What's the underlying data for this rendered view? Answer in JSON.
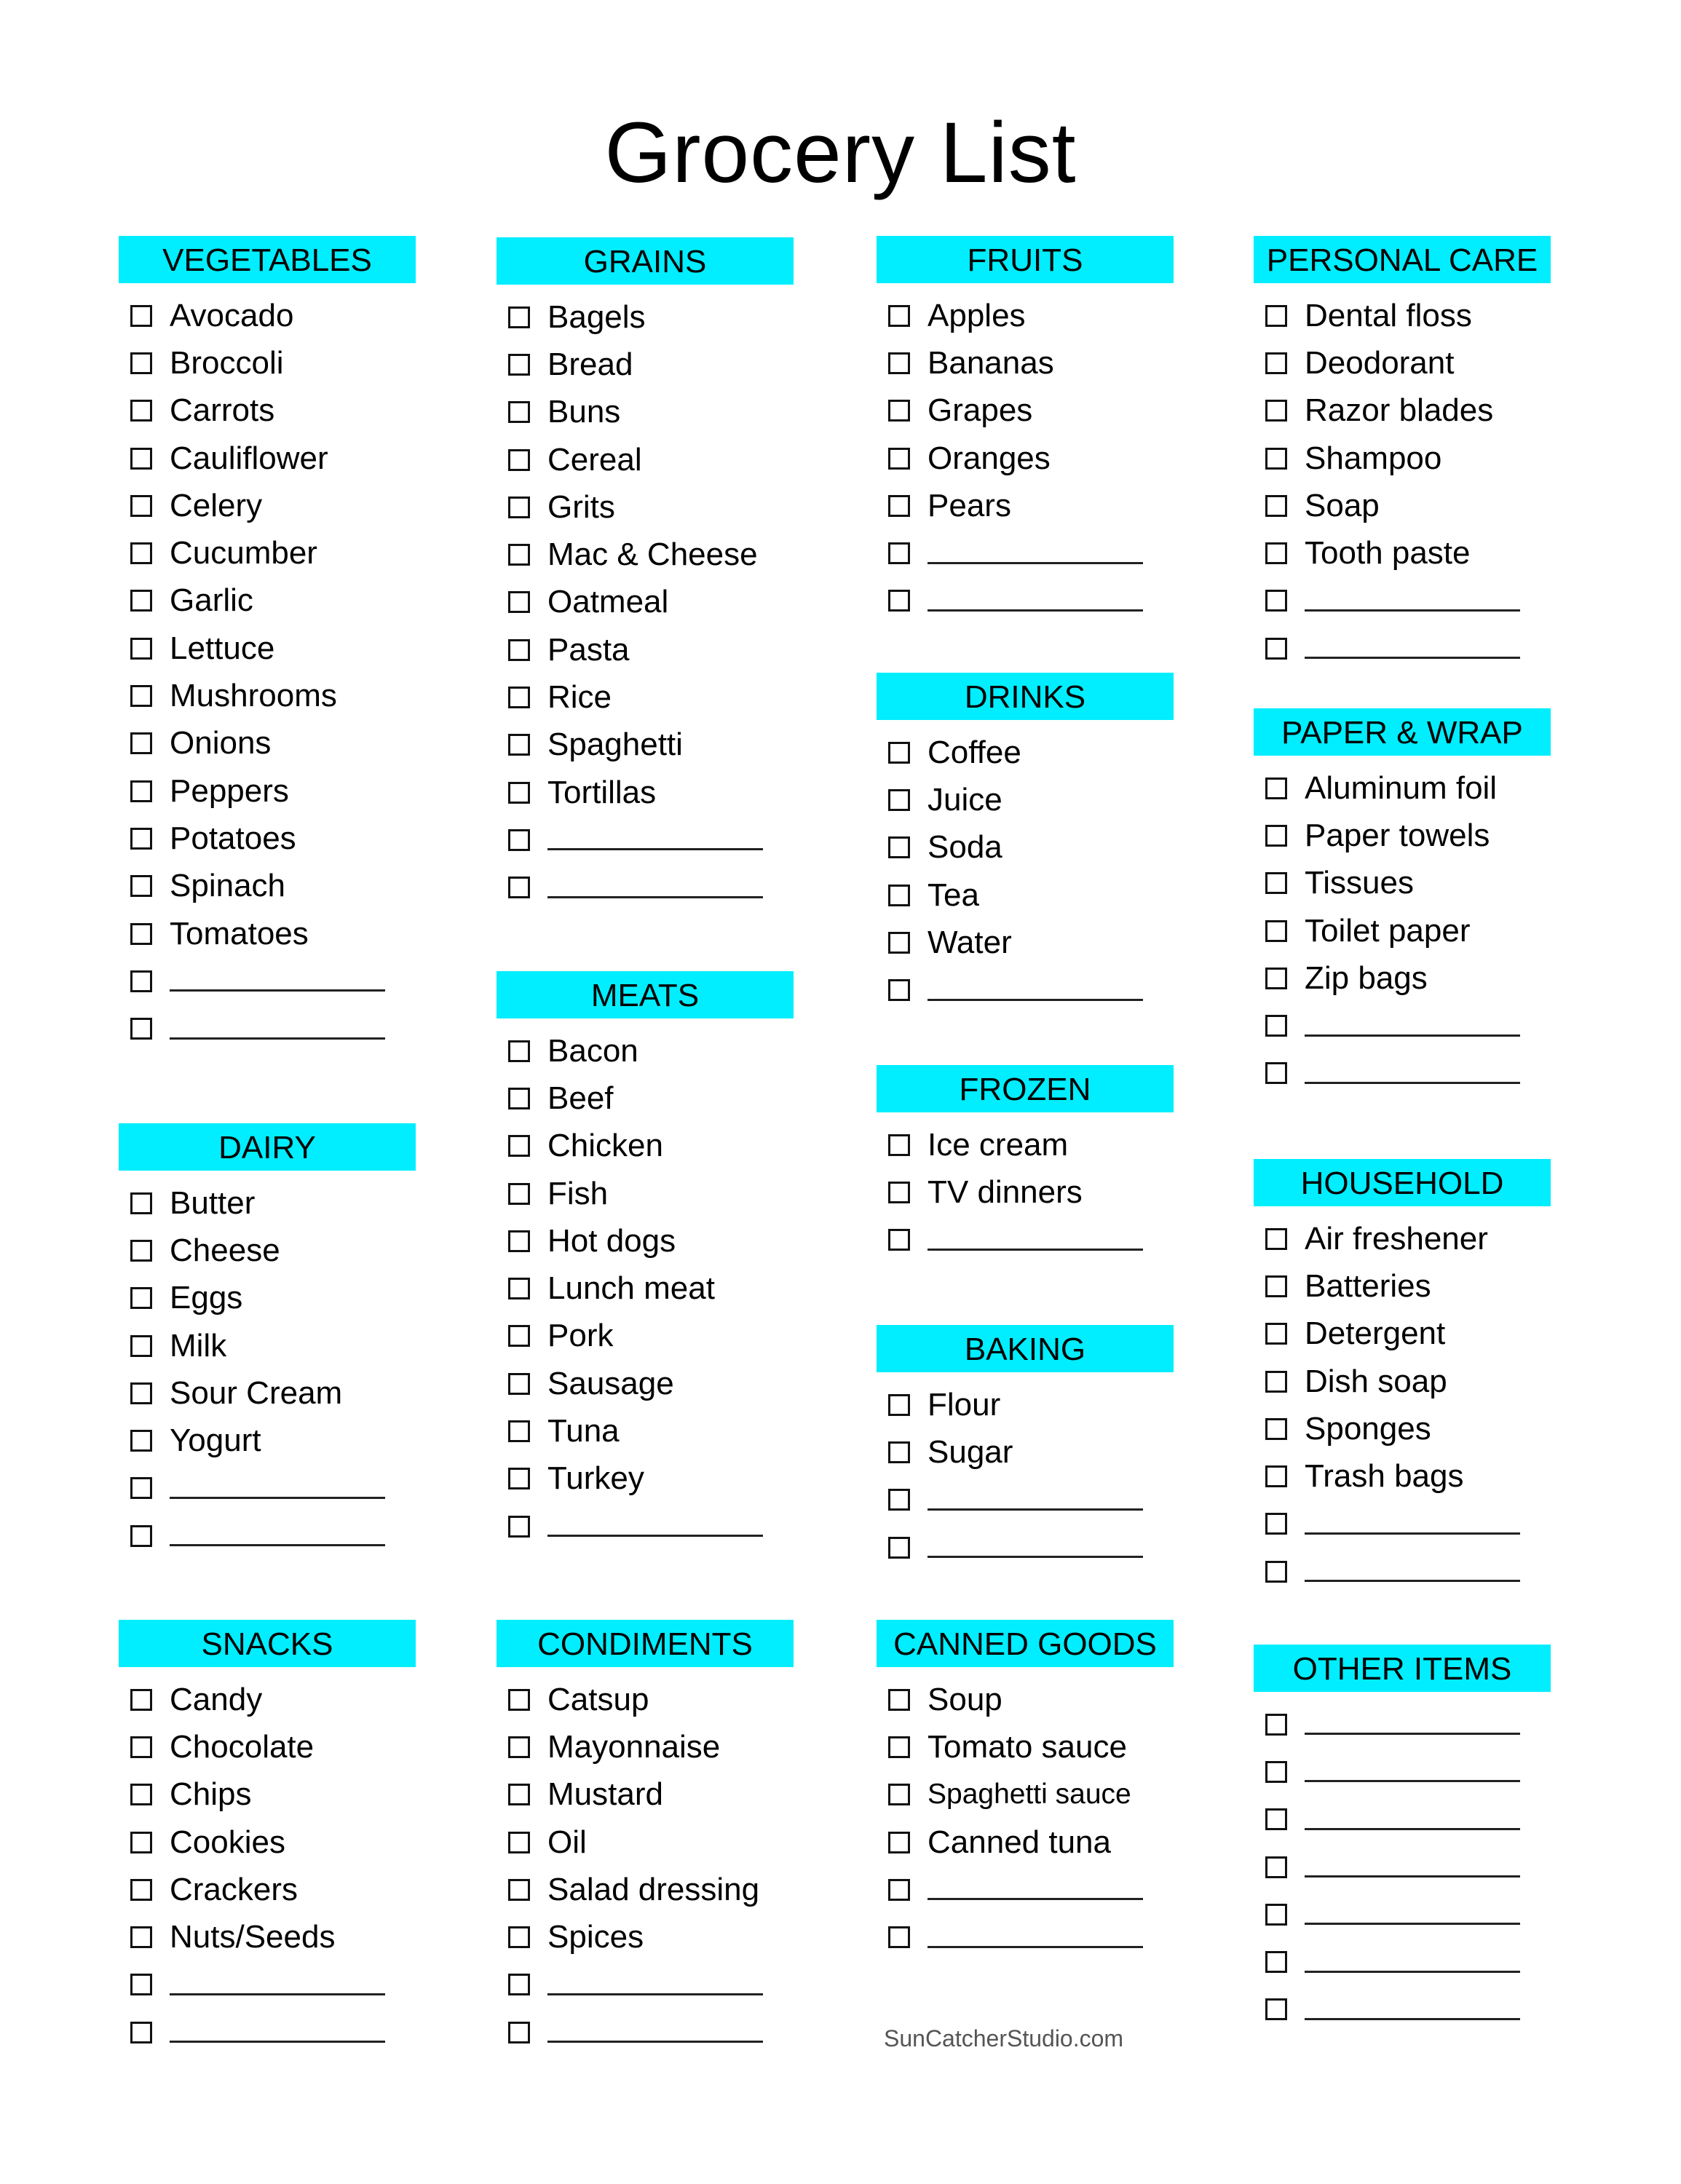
{
  "title": "Grocery List",
  "accent_color": "#00EEFF",
  "footer": "SunCatcherStudio.com",
  "sections": {
    "vegetables": {
      "title": "VEGETABLES",
      "items": [
        "Avocado",
        "Broccoli",
        "Carrots",
        "Cauliflower",
        "Celery",
        "Cucumber",
        "Garlic",
        "Lettuce",
        "Mushrooms",
        "Onions",
        "Peppers",
        "Potatoes",
        "Spinach",
        "Tomatoes",
        "",
        ""
      ]
    },
    "dairy": {
      "title": "DAIRY",
      "items": [
        "Butter",
        "Cheese",
        "Eggs",
        "Milk",
        "Sour Cream",
        "Yogurt",
        "",
        ""
      ]
    },
    "snacks": {
      "title": "SNACKS",
      "items": [
        "Candy",
        "Chocolate",
        "Chips",
        "Cookies",
        "Crackers",
        "Nuts/Seeds",
        "",
        ""
      ]
    },
    "grains": {
      "title": "GRAINS",
      "items": [
        "Bagels",
        "Bread",
        "Buns",
        "Cereal",
        "Grits",
        "Mac & Cheese",
        "Oatmeal",
        "Pasta",
        "Rice",
        "Spaghetti",
        "Tortillas",
        "",
        ""
      ]
    },
    "meats": {
      "title": "MEATS",
      "items": [
        "Bacon",
        "Beef",
        "Chicken",
        "Fish",
        "Hot dogs",
        "Lunch meat",
        "Pork",
        "Sausage",
        "Tuna",
        "Turkey",
        ""
      ]
    },
    "condiments": {
      "title": "CONDIMENTS",
      "items": [
        "Catsup",
        "Mayonnaise",
        "Mustard",
        "Oil",
        "Salad dressing",
        "Spices",
        "",
        ""
      ]
    },
    "fruits": {
      "title": "FRUITS",
      "items": [
        "Apples",
        "Bananas",
        "Grapes",
        "Oranges",
        "Pears",
        "",
        ""
      ]
    },
    "drinks": {
      "title": "DRINKS",
      "items": [
        "Coffee",
        "Juice",
        "Soda",
        "Tea",
        "Water",
        ""
      ]
    },
    "frozen": {
      "title": "FROZEN",
      "items": [
        "Ice cream",
        "TV dinners",
        ""
      ]
    },
    "baking": {
      "title": "BAKING",
      "items": [
        "Flour",
        "Sugar",
        "",
        ""
      ]
    },
    "canned_goods": {
      "title": "CANNED GOODS",
      "items": [
        "Soup",
        "Tomato sauce",
        "Spaghetti sauce",
        "Canned tuna",
        "",
        ""
      ]
    },
    "personal_care": {
      "title": "PERSONAL CARE",
      "items": [
        "Dental floss",
        "Deodorant",
        "Razor blades",
        "Shampoo",
        "Soap",
        "Tooth paste",
        "",
        ""
      ]
    },
    "paper_wrap": {
      "title": "PAPER & WRAP",
      "items": [
        "Aluminum foil",
        "Paper towels",
        "Tissues",
        "Toilet paper",
        "Zip bags",
        "",
        ""
      ]
    },
    "household": {
      "title": "HOUSEHOLD",
      "items": [
        "Air freshener",
        "Batteries",
        "Detergent",
        "Dish soap",
        "Sponges",
        "Trash bags",
        "",
        ""
      ]
    },
    "other_items": {
      "title": "OTHER ITEMS",
      "items": [
        "",
        "",
        "",
        "",
        "",
        "",
        ""
      ]
    }
  }
}
